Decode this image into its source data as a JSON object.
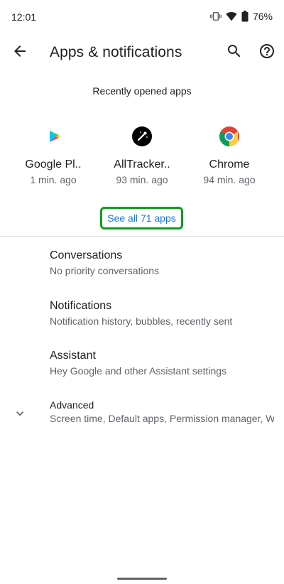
{
  "status_bar": {
    "time": "12:01",
    "battery": "76%",
    "icons": [
      "vibrate-icon",
      "wifi-icon",
      "battery-icon"
    ]
  },
  "toolbar": {
    "title": "Apps & notifications",
    "back_icon": "back-arrow-icon",
    "search_icon": "search-icon",
    "help_icon": "help-icon"
  },
  "recent": {
    "header": "Recently opened apps",
    "apps": [
      {
        "name": "Google Pl..",
        "time": "1 min. ago",
        "icon": "google-play-icon"
      },
      {
        "name": "AllTracker..",
        "time": "93 min. ago",
        "icon": "alltracker-icon"
      },
      {
        "name": "Chrome",
        "time": "94 min. ago",
        "icon": "chrome-icon"
      }
    ],
    "see_all_label": "See all 71 apps"
  },
  "list": {
    "items": [
      {
        "title": "Conversations",
        "summary": "No priority conversations"
      },
      {
        "title": "Notifications",
        "summary": "Notification history, bubbles, recently sent"
      },
      {
        "title": "Assistant",
        "summary": "Hey Google and other Assistant settings"
      },
      {
        "title": "Advanced",
        "summary": "Screen time, Default apps, Permission manager, Wi..."
      }
    ]
  },
  "colors": {
    "accent": "#1a73e8",
    "highlight_border": "#0f9d1c",
    "text_primary": "#202124",
    "text_secondary": "#5f6368"
  }
}
